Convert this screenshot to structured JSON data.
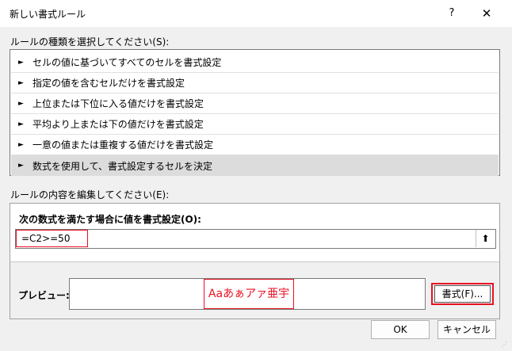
{
  "dialog": {
    "title": "新しい書式ルール",
    "help": "?",
    "close": "✕"
  },
  "rule_type": {
    "label": "ルールの種類を選択してください(S):",
    "bullet": "►",
    "items": [
      {
        "label": "セルの値に基づいてすべてのセルを書式設定",
        "selected": false
      },
      {
        "label": "指定の値を含むセルだけを書式設定",
        "selected": false
      },
      {
        "label": "上位または下位に入る値だけを書式設定",
        "selected": false
      },
      {
        "label": "平均より上または下の値だけを書式設定",
        "selected": false
      },
      {
        "label": "一意の値または重複する値だけを書式設定",
        "selected": false
      },
      {
        "label": "数式を使用して、書式設定するセルを決定",
        "selected": true
      }
    ]
  },
  "rule_edit": {
    "label": "ルールの内容を編集してください(E):",
    "condition_label": "次の数式を満たす場合に値を書式設定(O):",
    "formula_value": "=C2>=50",
    "collapse_icon": "⬆"
  },
  "preview": {
    "label": "プレビュー:",
    "sample_text": "Aaあぁアァ亜宇",
    "sample_color": "#e81123",
    "format_button": "書式(F)..."
  },
  "buttons": {
    "ok": "OK",
    "cancel": "キャンセル"
  },
  "grip_icon": "⋰"
}
